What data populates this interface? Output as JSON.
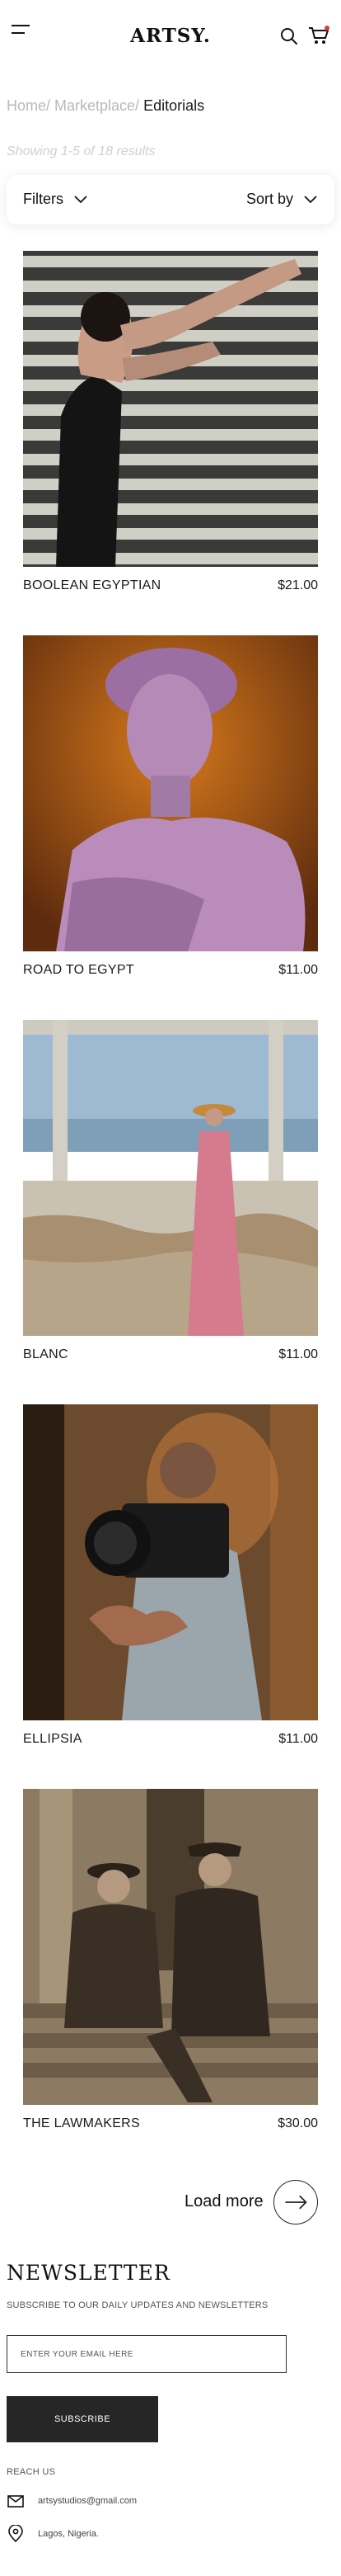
{
  "header": {
    "brand": "ARTSY.",
    "menu_icon": "hamburger-menu-icon",
    "search_icon": "search-icon",
    "cart_icon": "shopping-cart-icon",
    "cart_badge_color": "#e03a2f"
  },
  "breadcrumb": {
    "home": "Home/",
    "marketplace": " Marketplace/",
    "current": " Editorials"
  },
  "results_text": "Showing 1-5  of 18 results",
  "filters": {
    "filter_label": "Filters",
    "sort_label": "Sort by"
  },
  "products": [
    {
      "name": "BOOLEAN EGYPTIAN",
      "price": "$21.00"
    },
    {
      "name": "ROAD TO EGYPT",
      "price": "$11.00"
    },
    {
      "name": "BLANC",
      "price": "$11.00"
    },
    {
      "name": "ELLIPSIA",
      "price": "$11.00"
    },
    {
      "name": "THE LAWMAKERS",
      "price": "$30.00"
    }
  ],
  "load_more": {
    "label": "Load more"
  },
  "newsletter": {
    "title": "NEWSLETTER",
    "subtitle": "SUBSCRIBE TO OUR DAILY UPDATES AND NEWSLETTERS",
    "email_placeholder": "ENTER YOUR EMAIL HERE",
    "button_label": "SUBSCRIBE",
    "reach_us": "REACH US",
    "email": "artsystudios@gmail.com",
    "location": "Lagos, Nigeria."
  }
}
